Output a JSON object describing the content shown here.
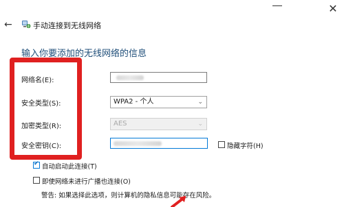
{
  "window": {
    "close_glyph": "✕"
  },
  "header": {
    "back_glyph": "←",
    "title": "手动连接到无线网络"
  },
  "main": {
    "heading": "输入你要添加的无线网络的信息",
    "fields": [
      {
        "label": "网络名(E):"
      },
      {
        "label": "安全类型(S):",
        "value": "WPA2 - 个人"
      },
      {
        "label": "加密类型(R):",
        "value": "AES"
      },
      {
        "label": "安全密钥(C):"
      }
    ],
    "hide_chars_label": "隐藏字符(H)",
    "auto_connect_label": "自动启动此连接(T)",
    "connect_not_broadcast_label": "即使网络未进行广播也连接(O)",
    "warning": "警告: 如果选择此选项，则计算机的隐私信息可能存在风险。"
  },
  "annotation": {
    "frame_color": "#e02020"
  },
  "colors": {
    "accent": "#0078d7",
    "heading": "#1f4e79"
  }
}
